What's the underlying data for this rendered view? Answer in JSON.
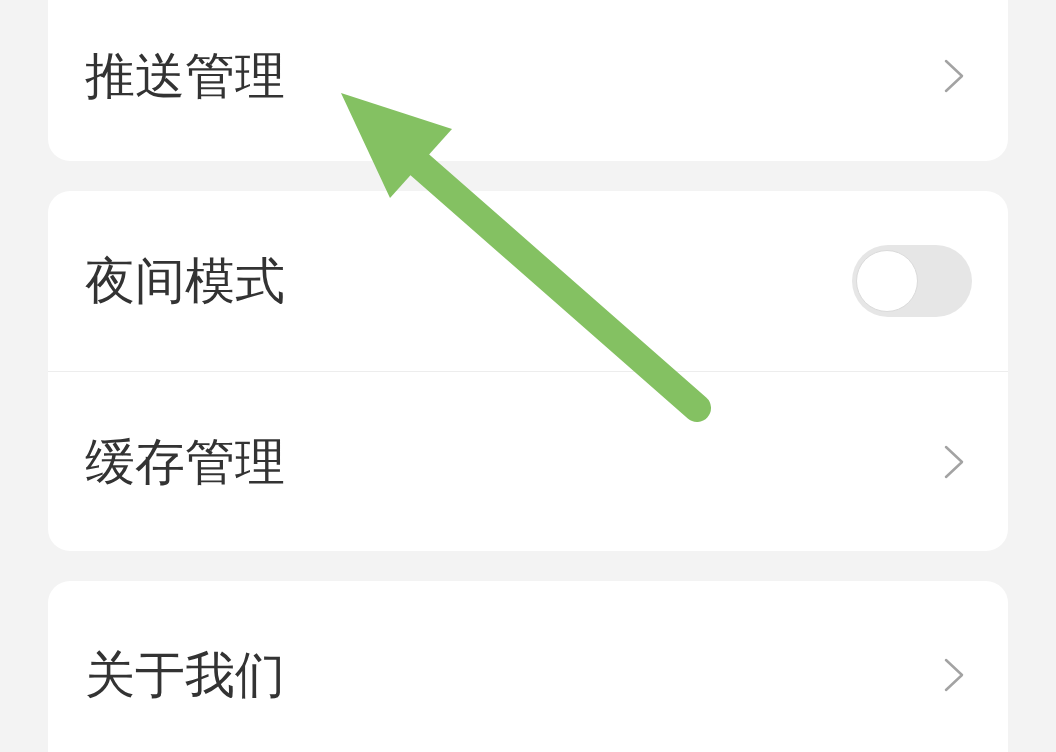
{
  "groups": [
    {
      "items": [
        {
          "kind": "link",
          "label": "推送管理"
        }
      ]
    },
    {
      "items": [
        {
          "kind": "toggle",
          "label": "夜间模式",
          "on": false
        },
        {
          "kind": "link",
          "label": "缓存管理"
        }
      ]
    },
    {
      "items": [
        {
          "kind": "link",
          "label": "关于我们"
        }
      ]
    }
  ]
}
